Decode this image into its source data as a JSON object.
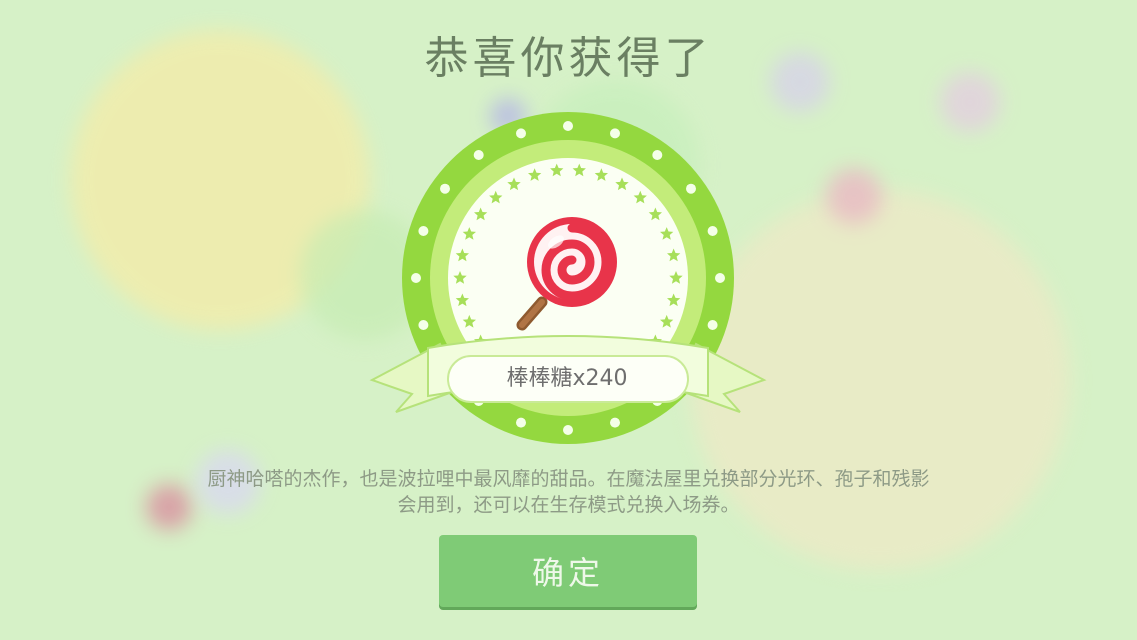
{
  "dialog": {
    "title": "恭喜你获得了",
    "reward": {
      "item_name": "棒棒糖",
      "quantity_text": "x240",
      "icon": "lollipop-icon"
    },
    "description_line1": "厨神哈嗒的杰作，也是波拉哩中最风靡的甜品。在魔法屋里兑换部分光环、孢子和残影",
    "description_line2": "会用到，还可以在生存模式兑换入场券。",
    "confirm_label": "确定"
  },
  "colors": {
    "background": "#d6f1c7",
    "badge_outer": "#8fd23a",
    "badge_ring": "#b8e86a",
    "badge_inner": "#fbfff3",
    "button": "#7fcb76",
    "title_text": "#6a7f62"
  }
}
